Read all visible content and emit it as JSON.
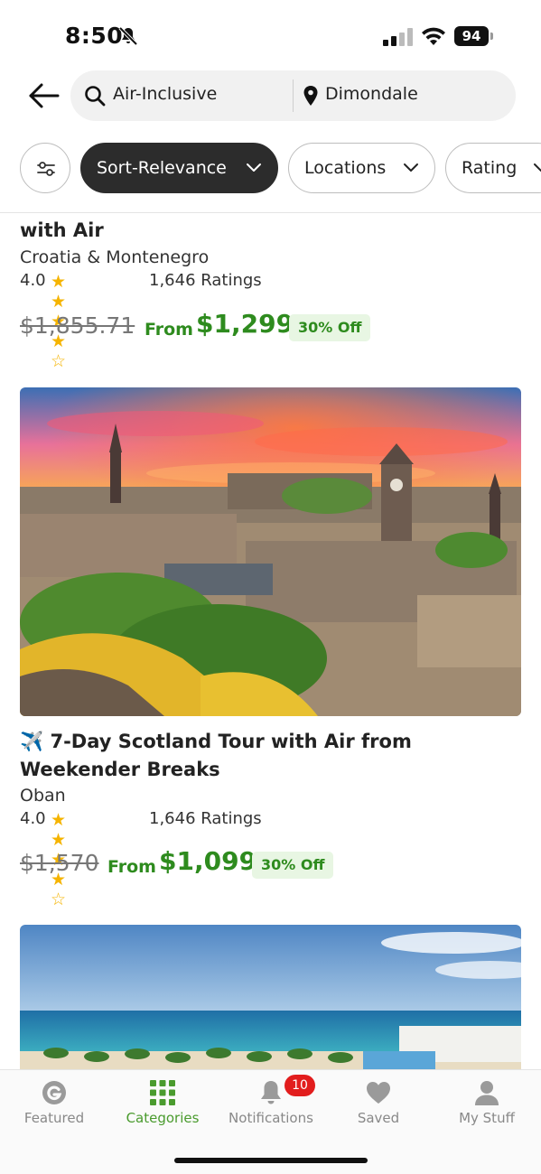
{
  "status": {
    "time": "8:50",
    "battery": "94"
  },
  "search": {
    "query": "Air-Inclusive",
    "location": "Dimondale"
  },
  "filters": {
    "sort": "Sort-Relevance",
    "locations": "Locations",
    "rating": "Rating"
  },
  "cards": [
    {
      "title": "with Air",
      "location": "Croatia & Montenegro",
      "rating": "4.0",
      "stars": 4,
      "ratings_count": "1,646 Ratings",
      "old_price": "$1,855.71",
      "from": "From",
      "price": "$1,299",
      "discount": "30% Off"
    },
    {
      "title": "✈️ 7-Day Scotland Tour with Air from Weekender Breaks",
      "location": "Oban",
      "rating": "4.0",
      "stars": 4,
      "ratings_count": "1,646 Ratings",
      "old_price": "$1,570",
      "from": "From",
      "price": "$1,099",
      "discount": "30% Off",
      "image": "Edinburgh skyline at sunset"
    },
    {
      "image": "beach with palm trees"
    }
  ],
  "tabs": [
    {
      "label": "Featured",
      "icon": "g-logo-icon"
    },
    {
      "label": "Categories",
      "icon": "grid-icon",
      "active": true
    },
    {
      "label": "Notifications",
      "icon": "bell-icon",
      "badge": "10"
    },
    {
      "label": "Saved",
      "icon": "heart-icon"
    },
    {
      "label": "My Stuff",
      "icon": "user-icon"
    }
  ],
  "colors": {
    "price_green": "#2e8b1e",
    "active_tab": "#4a9b2e",
    "star": "#f5b400",
    "badge": "#e21d1d"
  }
}
